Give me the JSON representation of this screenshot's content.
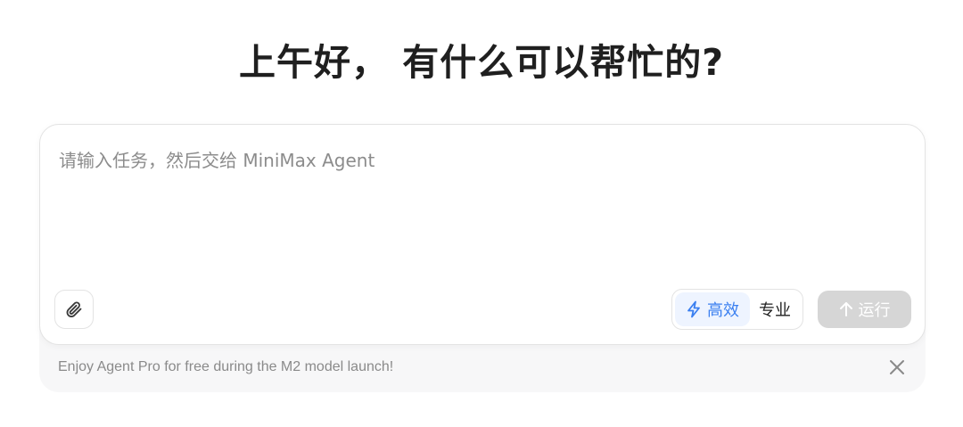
{
  "header": {
    "greeting": "上午好， 有什么可以帮忙的?"
  },
  "composer": {
    "placeholder": "请输入任务，然后交给 MiniMax Agent",
    "value": "",
    "attach_icon": "paperclip-icon",
    "modes": [
      {
        "label": "高效",
        "icon": "lightning-icon",
        "selected": true
      },
      {
        "label": "专业",
        "selected": false
      }
    ],
    "run_label": "运行",
    "run_icon": "arrow-up-icon",
    "run_enabled": false
  },
  "banner": {
    "text": "Enjoy Agent Pro for free during the M2 model launch!",
    "close_icon": "close-icon"
  },
  "colors": {
    "accent": "#3a7ff0",
    "accent_bg": "#eef4ff",
    "disabled_button": "#d6d6d6",
    "banner_bg": "#f7f7f8"
  }
}
